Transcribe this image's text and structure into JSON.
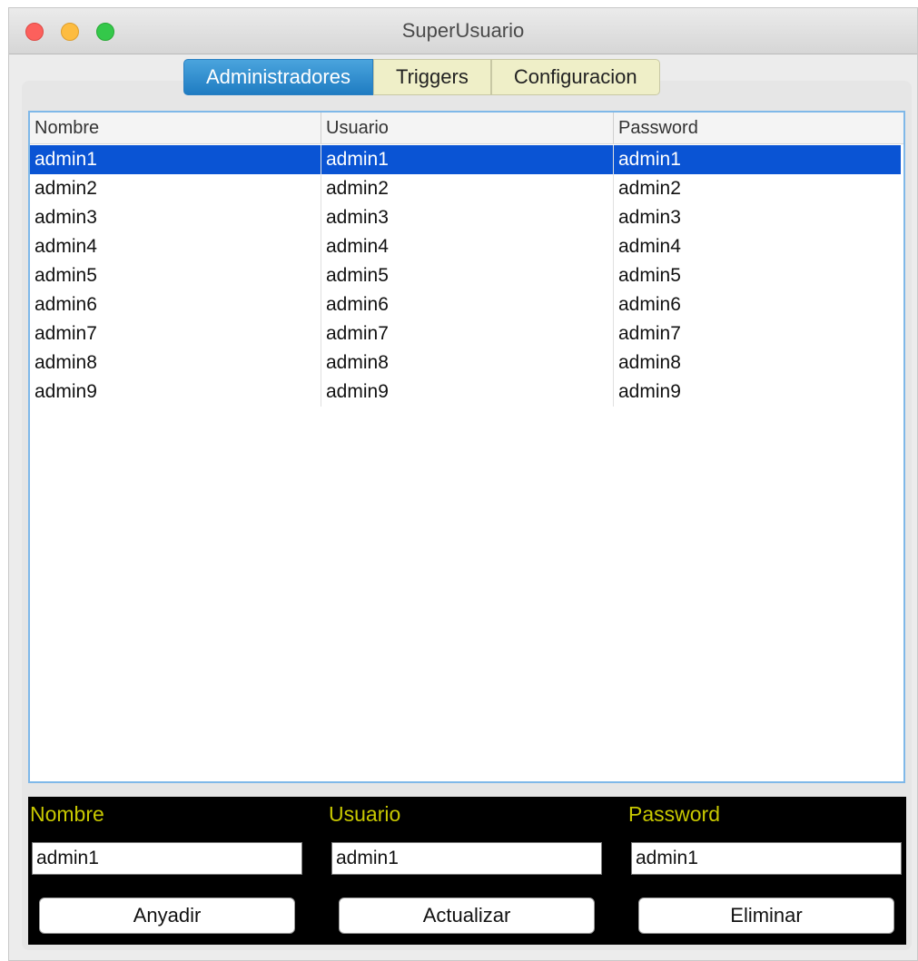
{
  "window": {
    "title": "SuperUsuario"
  },
  "tabs": [
    {
      "label": "Administradores",
      "active": true
    },
    {
      "label": "Triggers",
      "active": false
    },
    {
      "label": "Configuracion",
      "active": false
    }
  ],
  "table": {
    "columns": [
      "Nombre",
      "Usuario",
      "Password"
    ],
    "selected_row": 0,
    "rows": [
      [
        "admin1",
        "admin1",
        "admin1"
      ],
      [
        "admin2",
        "admin2",
        "admin2"
      ],
      [
        "admin3",
        "admin3",
        "admin3"
      ],
      [
        "admin4",
        "admin4",
        "admin4"
      ],
      [
        "admin5",
        "admin5",
        "admin5"
      ],
      [
        "admin6",
        "admin6",
        "admin6"
      ],
      [
        "admin7",
        "admin7",
        "admin7"
      ],
      [
        "admin8",
        "admin8",
        "admin8"
      ],
      [
        "admin9",
        "admin9",
        "admin9"
      ]
    ]
  },
  "form": {
    "nombre_label": "Nombre",
    "usuario_label": "Usuario",
    "password_label": "Password",
    "nombre_value": "admin1",
    "usuario_value": "admin1",
    "password_value": "admin1",
    "add_label": "Anyadir",
    "update_label": "Actualizar",
    "delete_label": "Eliminar"
  },
  "colors": {
    "selection": "#0a54d4",
    "active_tab": "#1f7cc2",
    "inactive_tab": "#efefc8",
    "form_background": "#000000",
    "form_label": "#c8c800"
  }
}
